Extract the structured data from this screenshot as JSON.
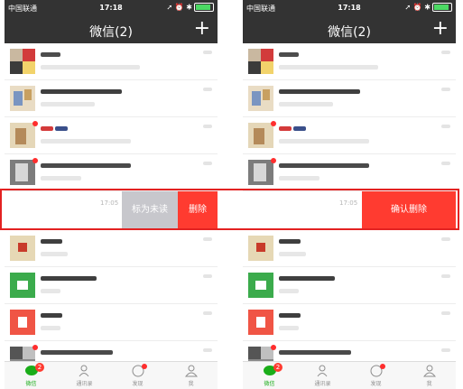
{
  "status": {
    "carrier": "中国联通",
    "time": "17:18"
  },
  "nav": {
    "title": "微信(2)",
    "plus": "+"
  },
  "swiped_time": "17:05",
  "left_actions": {
    "mark_unread": "标为未读",
    "delete": "删除"
  },
  "right_actions": {
    "confirm_delete": "确认删除"
  },
  "tabs": [
    {
      "label": "微信",
      "badge": "2"
    },
    {
      "label": "通讯录"
    },
    {
      "label": "发现"
    },
    {
      "label": "我"
    }
  ],
  "colors": {
    "bar": "#333333",
    "wechat_green": "#1aad19",
    "delete_red": "#ff3b30",
    "unread_gray": "#c7c7cc",
    "frame_red": "#e32222"
  }
}
